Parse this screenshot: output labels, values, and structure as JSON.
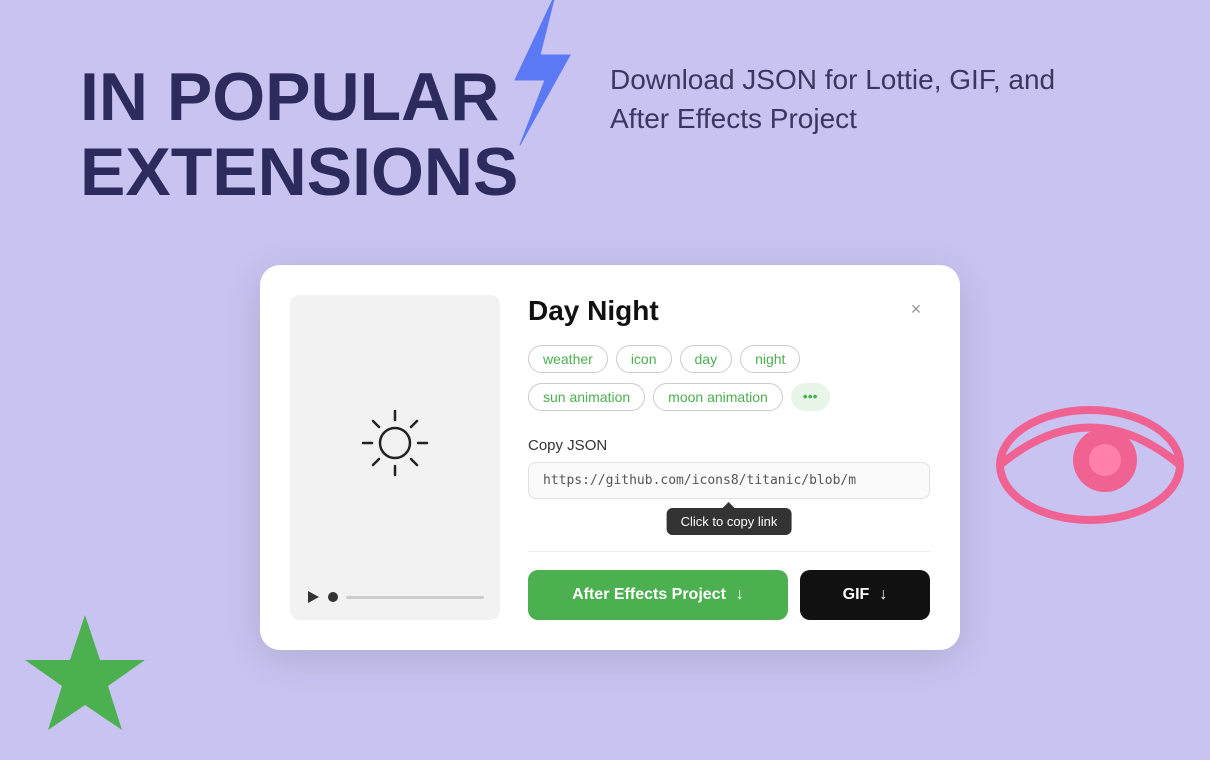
{
  "header": {
    "title_line1": "IN POPULAR",
    "title_line2": "EXTENSIONS",
    "subtitle": "Download JSON for Lottie, GIF, and After Effects Project"
  },
  "modal": {
    "title": "Day Night",
    "close_label": "×",
    "tags": [
      {
        "label": "weather"
      },
      {
        "label": "icon"
      },
      {
        "label": "day"
      },
      {
        "label": "night"
      },
      {
        "label": "sun animation"
      },
      {
        "label": "moon animation"
      }
    ],
    "more_label": "•••",
    "copy_json_label": "Copy JSON",
    "json_url": "https://github.com/icons8/titanic/blob/m",
    "tooltip_label": "Click to copy link",
    "btn_ae_label": "After Effects Project",
    "btn_gif_label": "GIF",
    "colors": {
      "ae_btn_bg": "#4caf50",
      "gif_btn_bg": "#111111",
      "tag_color": "#4caf50",
      "bg": "#c8c3f0"
    }
  }
}
